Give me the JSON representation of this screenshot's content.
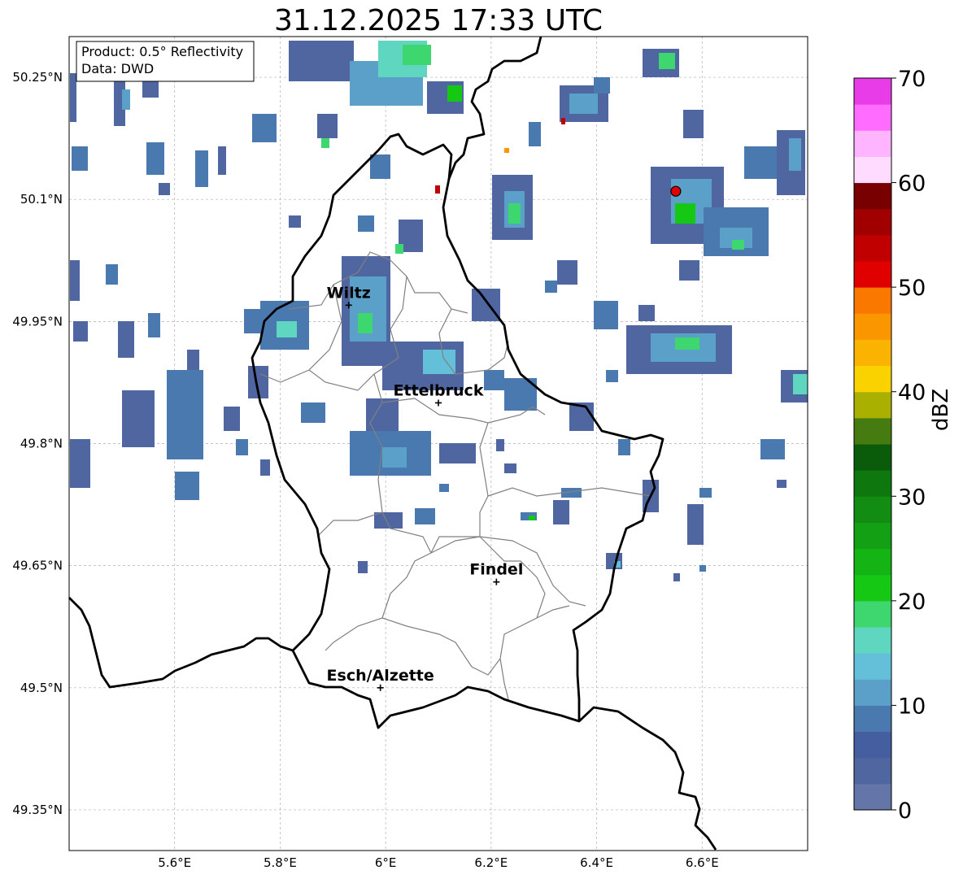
{
  "title": "31.12.2025 17:33 UTC",
  "info_box": {
    "product": "Product: 0.5° Reflectivity",
    "source": "Data: DWD"
  },
  "map": {
    "lon_range": [
      5.4,
      6.8
    ],
    "lat_range": [
      49.3,
      50.3
    ],
    "lon_ticks": [
      "5.6°E",
      "5.8°E",
      "6°E",
      "6.2°E",
      "6.4°E",
      "6.6°E"
    ],
    "lat_ticks": [
      "50.25°N",
      "50.1°N",
      "49.95°N",
      "49.8°N",
      "49.65°N",
      "49.5°N",
      "49.35°N"
    ],
    "grid": true,
    "cities": [
      {
        "name": "Wiltz",
        "lon": 5.93,
        "lat": 49.97
      },
      {
        "name": "Ettelbruck",
        "lon": 6.1,
        "lat": 49.85
      },
      {
        "name": "Findel",
        "lon": 6.21,
        "lat": 49.63
      },
      {
        "name": "Esch/Alzette",
        "lon": 5.99,
        "lat": 49.5
      }
    ],
    "radar_site": {
      "lon": 6.55,
      "lat": 50.11,
      "color": "#e00000"
    }
  },
  "colorbar": {
    "label": "dBZ",
    "min": 0,
    "max": 70,
    "step": 2.5,
    "tick_labels": [
      "0",
      "10",
      "20",
      "30",
      "40",
      "50",
      "60",
      "70"
    ],
    "colors": [
      "#6475a8",
      "#4f66a0",
      "#445ea0",
      "#4a79b0",
      "#5aa0c8",
      "#64c0d8",
      "#5ed6c0",
      "#3ed66e",
      "#14c814",
      "#14b414",
      "#14a014",
      "#128c12",
      "#0e780e",
      "#0a5c0a",
      "#457b10",
      "#aab000",
      "#fad200",
      "#fab400",
      "#fa9600",
      "#fa7800",
      "#e00000",
      "#c00000",
      "#a00000",
      "#780000",
      "#ffdcff",
      "#ffb4ff",
      "#ff6cff",
      "#e83ce8"
    ]
  }
}
